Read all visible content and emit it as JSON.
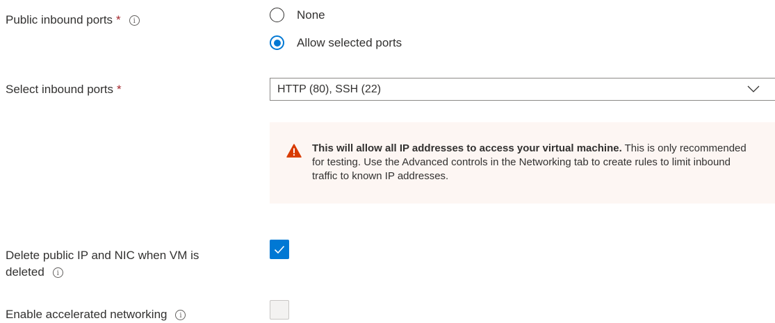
{
  "public_inbound_ports": {
    "label": "Public inbound ports",
    "required_mark": "*",
    "info_glyph": "i",
    "options": [
      {
        "label": "None",
        "selected": false
      },
      {
        "label": "Allow selected ports",
        "selected": true
      }
    ]
  },
  "select_inbound_ports": {
    "label": "Select inbound ports",
    "required_mark": "*",
    "value": "HTTP (80), SSH (22)"
  },
  "warning": {
    "icon": "warning-triangle-icon",
    "bold_text": "This will allow all IP addresses to access your virtual machine.",
    "text": " This is only recommended for testing.  Use the Advanced controls in the Networking tab to create rules to limit inbound traffic to known IP addresses."
  },
  "delete_public_ip": {
    "label_line1": "Delete public IP and NIC when VM is",
    "label_line2": "deleted",
    "info_glyph": "i",
    "checked": true
  },
  "accelerated_networking": {
    "label": "Enable accelerated networking",
    "info_glyph": "i",
    "checked": false
  },
  "colors": {
    "accent": "#0078d4",
    "required": "#a4262c",
    "warning_bg": "#fdf6f3",
    "warning_icon": "#d83b01"
  }
}
